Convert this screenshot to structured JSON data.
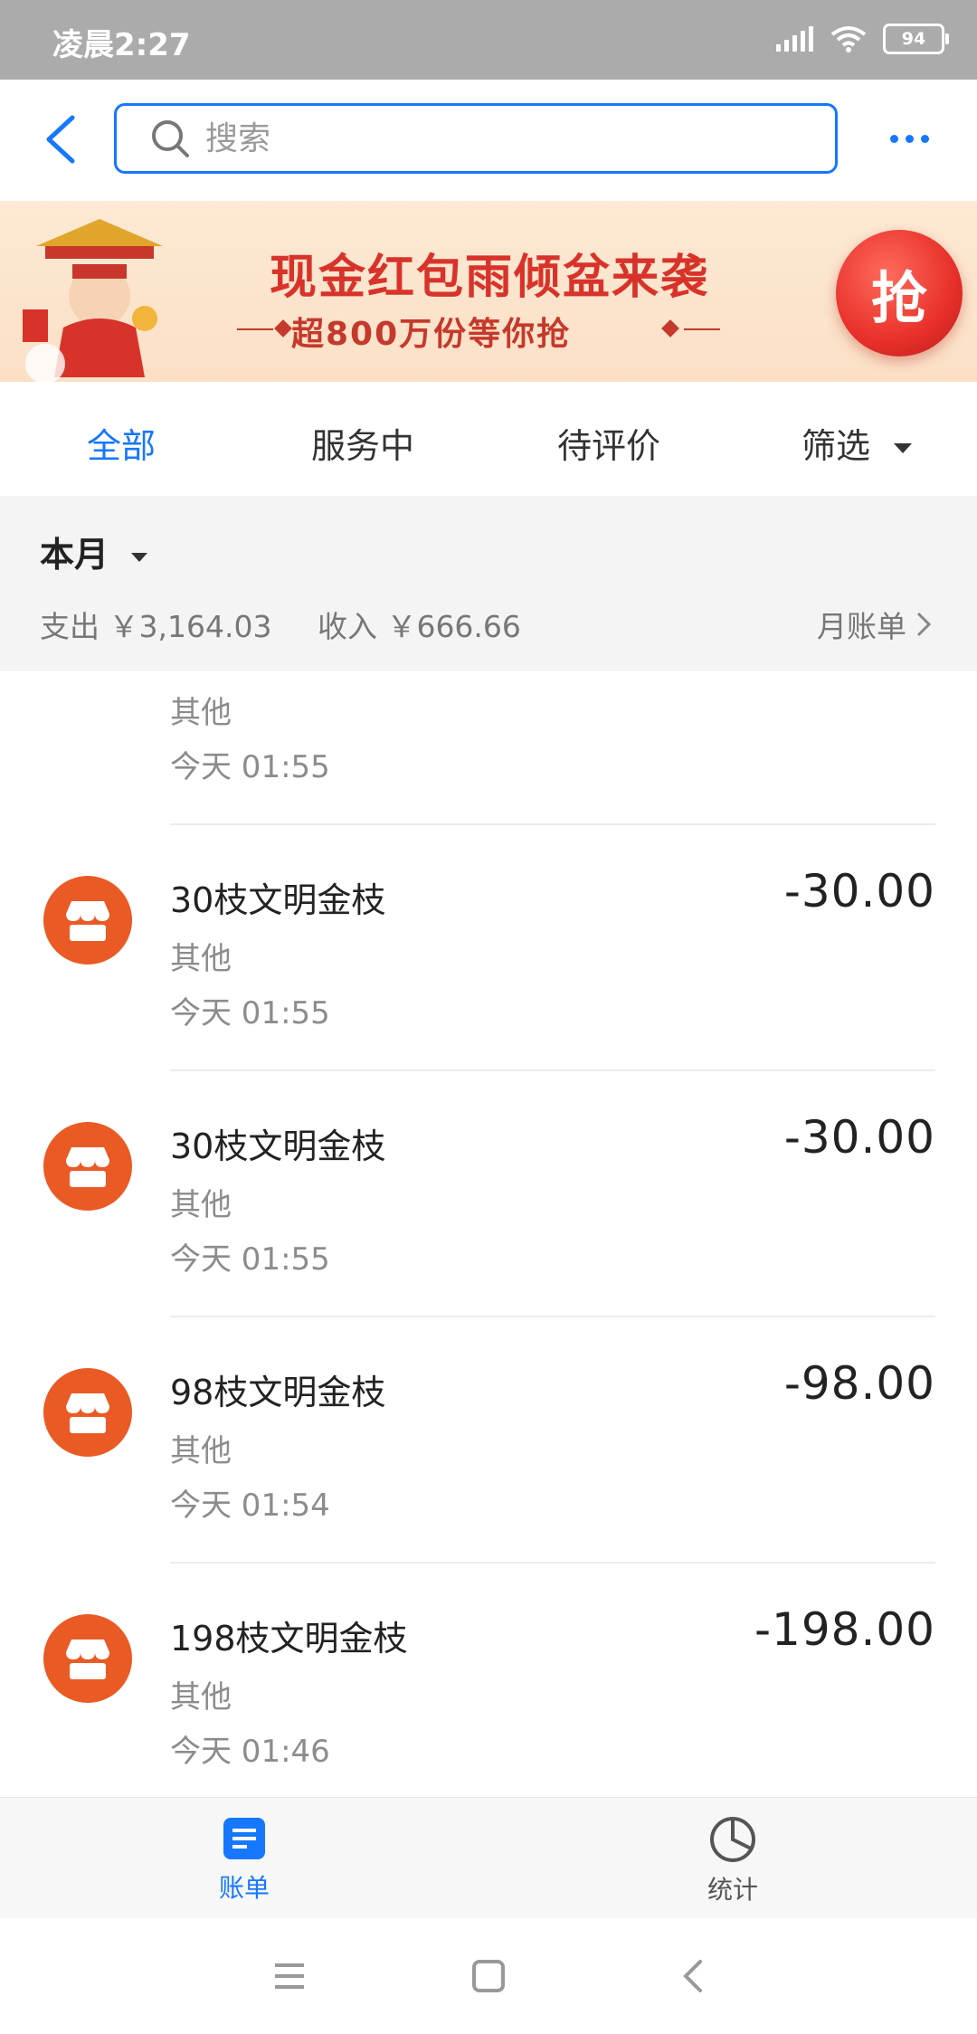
{
  "status_bar": {
    "time": "凌晨2:27",
    "battery": "94"
  },
  "search": {
    "placeholder": "搜索"
  },
  "banner": {
    "title": "现金红包雨倾盆来袭",
    "subtitle": "超800万份等你抢",
    "button": "抢"
  },
  "tabs": [
    {
      "label": "全部",
      "active": true
    },
    {
      "label": "服务中",
      "active": false
    },
    {
      "label": "待评价",
      "active": false
    },
    {
      "label": "筛选",
      "active": false
    }
  ],
  "summary": {
    "period": "本月",
    "expense": "支出 ￥3,164.03",
    "income": "收入 ￥666.66",
    "monthly_bill": "月账单"
  },
  "transactions": [
    {
      "name": "",
      "category": "其他",
      "time": "今天  01:55",
      "amount": ""
    },
    {
      "name": "30枝文明金枝",
      "category": "其他",
      "time": "今天  01:55",
      "amount": "-30.00"
    },
    {
      "name": "30枝文明金枝",
      "category": "其他",
      "time": "今天  01:55",
      "amount": "-30.00"
    },
    {
      "name": "98枝文明金枝",
      "category": "其他",
      "time": "今天  01:54",
      "amount": "-98.00"
    },
    {
      "name": "198枝文明金枝",
      "category": "其他",
      "time": "今天  01:46",
      "amount": "-198.00"
    }
  ],
  "bottom_tabs": [
    {
      "label": "账单",
      "icon": "bill-icon",
      "active": true
    },
    {
      "label": "统计",
      "icon": "pie-chart-icon",
      "active": false
    }
  ],
  "colors": {
    "accent": "#1677ff",
    "merchant_avatar": "#ea5a25",
    "banner_red": "#d8332a"
  }
}
